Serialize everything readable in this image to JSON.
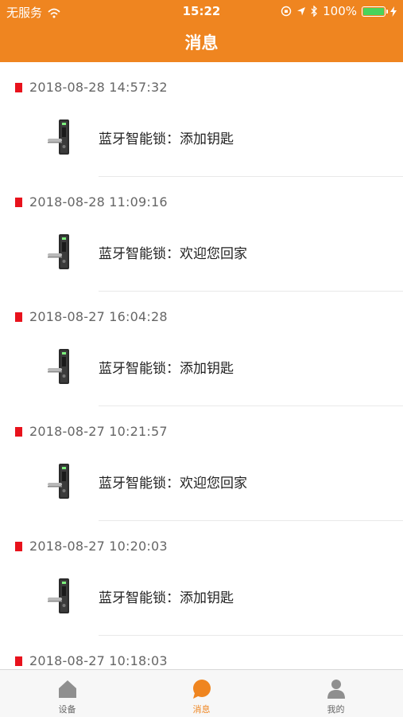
{
  "status_bar": {
    "carrier": "无服务",
    "time": "15:22",
    "battery": "100%",
    "battery_level": 1.0
  },
  "nav": {
    "title": "消息"
  },
  "messages": [
    {
      "date": "2018-08-28 14:57:32",
      "text": "蓝牙智能锁：添加钥匙"
    },
    {
      "date": "2018-08-28 11:09:16",
      "text": "蓝牙智能锁：欢迎您回家"
    },
    {
      "date": "2018-08-27 16:04:28",
      "text": "蓝牙智能锁：添加钥匙"
    },
    {
      "date": "2018-08-27 10:21:57",
      "text": "蓝牙智能锁：欢迎您回家"
    },
    {
      "date": "2018-08-27 10:20:03",
      "text": "蓝牙智能锁：添加钥匙"
    },
    {
      "date": "2018-08-27 10:18:03",
      "text": ""
    }
  ],
  "tabs": [
    {
      "label": "设备",
      "icon": "home-icon",
      "active": false
    },
    {
      "label": "消息",
      "icon": "chat-bubble-icon",
      "active": true
    },
    {
      "label": "我的",
      "icon": "person-icon",
      "active": false
    }
  ],
  "colors": {
    "accent": "#ef8520",
    "marker": "#e8121c",
    "battery": "#49d35b"
  }
}
